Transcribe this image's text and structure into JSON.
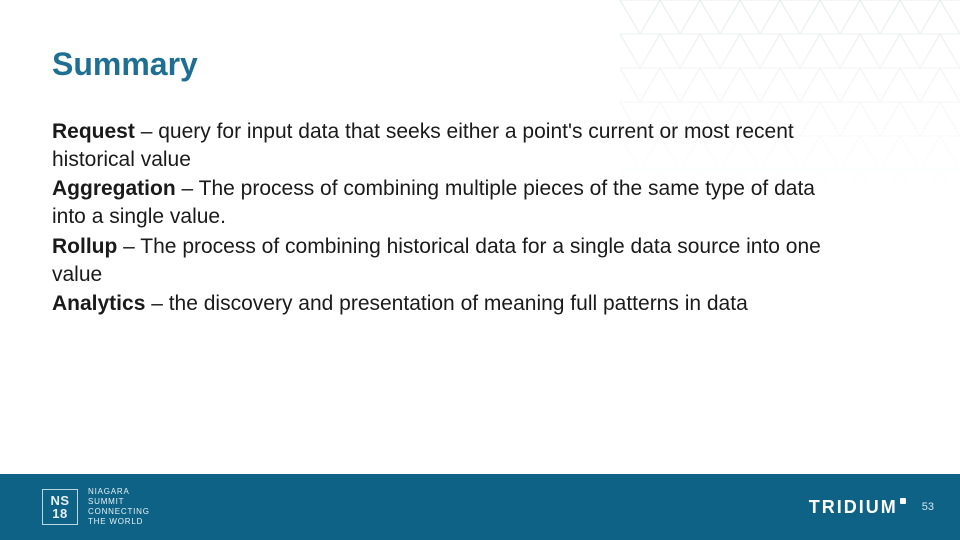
{
  "title": "Summary",
  "definitions": [
    {
      "term": "Request",
      "text": " – query for input data that seeks either a point's current or most recent historical value"
    },
    {
      "term": "Aggregation",
      "text": " – The process of combining multiple pieces of the same type of data into a single value."
    },
    {
      "term": "Rollup",
      "text": " – The process of combining historical data for a single data source into one value"
    },
    {
      "term": "Analytics",
      "text": " – the discovery and presentation of meaning full patterns in data"
    }
  ],
  "footer": {
    "badge_ns": "NS",
    "badge_year": "18",
    "badge_line1": "NIAGARA",
    "badge_line2": "SUMMIT",
    "badge_line3": "CONNECTING",
    "badge_line4": "THE WORLD",
    "brand": "TRIDIUM",
    "page": "53"
  },
  "colors": {
    "accent": "#1f6f93",
    "footer_bg": "#0d6285"
  }
}
